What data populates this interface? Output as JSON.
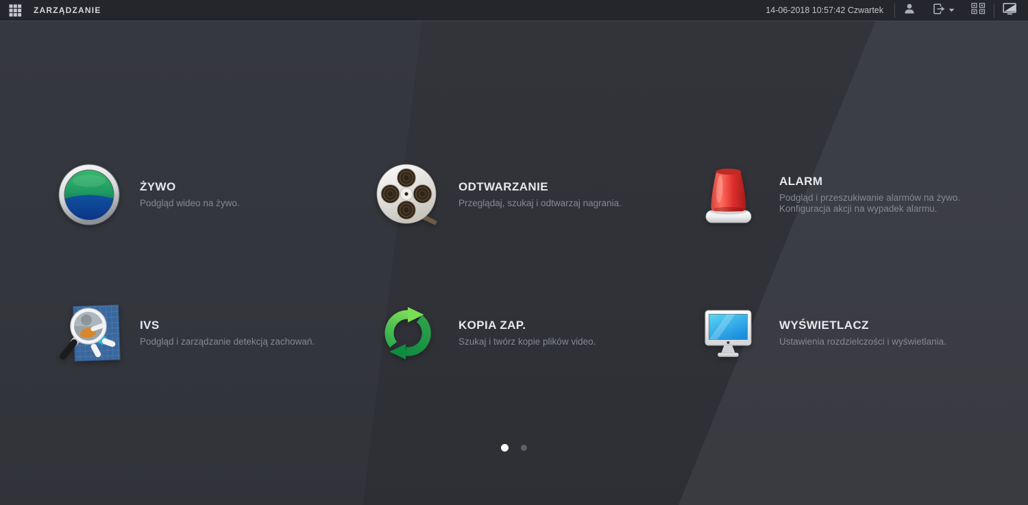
{
  "titlebar": {
    "app_title": "ZARZĄDZANIE",
    "datetime": "14-06-2018 10:57:42 Czwartek",
    "icons": [
      "apps-grid",
      "user",
      "logout",
      "channel-config",
      "screen-adjust"
    ]
  },
  "menu": {
    "items": [
      {
        "id": "live",
        "icon": "live-eye",
        "title": "ŻYWO",
        "desc1": "Podgląd wideo na żywo.",
        "desc2": ""
      },
      {
        "id": "playback",
        "icon": "film-reel",
        "title": "ODTWARZANIE",
        "desc1": "Przeglądaj, szukaj i odtwarzaj nagrania.",
        "desc2": ""
      },
      {
        "id": "alarm",
        "icon": "siren",
        "title": "ALARM",
        "desc1": "Podgląd i przeszukiwanie alarmów na żywo.",
        "desc2": "Konfiguracja akcji na wypadek alarmu."
      },
      {
        "id": "ivs",
        "icon": "magnifier-grid",
        "title": "IVS",
        "desc1": "Podgląd i zarządzanie detekcją zachowań.",
        "desc2": ""
      },
      {
        "id": "backup",
        "icon": "sync-arrows",
        "title": "KOPIA ZAP.",
        "desc1": "Szukaj i twórz kopie plików video.",
        "desc2": ""
      },
      {
        "id": "display",
        "icon": "monitor",
        "title": "WYŚWIETLACZ",
        "desc1": "Ustawienia rozdzielczości i wyświetlania.",
        "desc2": ""
      }
    ]
  },
  "pagination": {
    "total_pages": 2,
    "active_page": 1
  },
  "colors": {
    "titlebar_bg": "#24262c",
    "background": "#34363d",
    "accent_green": "#2fae63",
    "accent_blue": "#0d47a1",
    "accent_red": "#e03430",
    "text_title": "#e8e9eb",
    "text_desc": "#85898f"
  }
}
